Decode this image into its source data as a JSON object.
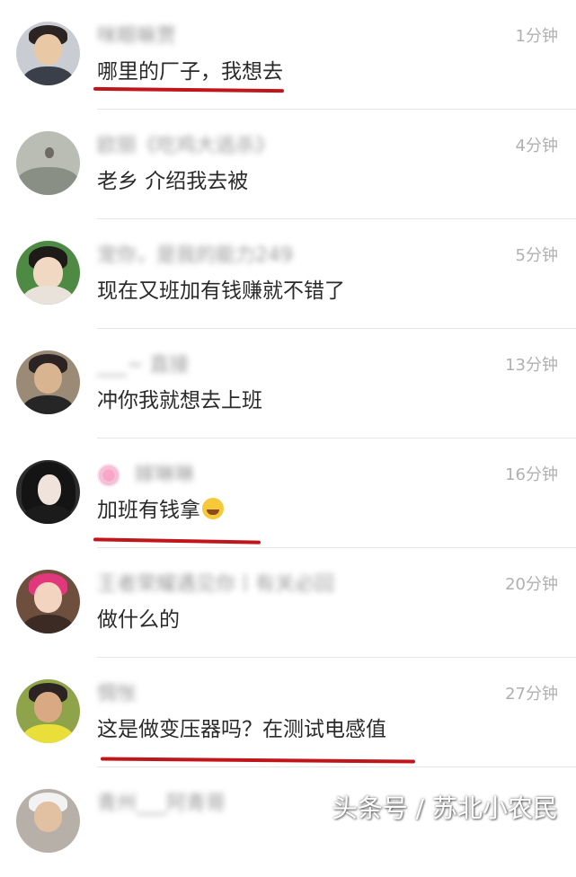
{
  "comments": [
    {
      "user": "咪眼嘛贾",
      "time": "1分钟",
      "text": "哪里的厂子，我想去",
      "underlined": true
    },
    {
      "user": "欧丽《吃鸡大逃杀》",
      "time": "4分钟",
      "text": "老乡 介绍我去被",
      "underlined": false
    },
    {
      "user": "宠你，是我的能力249",
      "time": "5分钟",
      "text": "现在又班加有钱赚就不错了",
      "underlined": false
    },
    {
      "user": "___~ 直接",
      "time": "13分钟",
      "text": "冲你我就想去上班",
      "underlined": false
    },
    {
      "user": "嫁琳琳",
      "time": "16分钟",
      "text": "加班有钱拿",
      "underlined": true
    },
    {
      "user": "王者荣耀遇见你丨有关必回",
      "time": "20分钟",
      "text": "做什么的",
      "underlined": false
    },
    {
      "user": "惆怅",
      "time": "27分钟",
      "text": "这是做变压器吗？在测试电感值",
      "underlined": true
    },
    {
      "user": "青州___阿青哥",
      "time": "",
      "text": "",
      "underlined": false
    }
  ],
  "watermark": "头条号 / 苏北小农民",
  "colors": {
    "underline": "#c0151a",
    "time": "#b0b0b0",
    "divider": "#e6e6e6"
  },
  "icons": {
    "laugh_emoji": "face-with-tears-of-joy-icon",
    "flower_badge": "flower-icon"
  }
}
